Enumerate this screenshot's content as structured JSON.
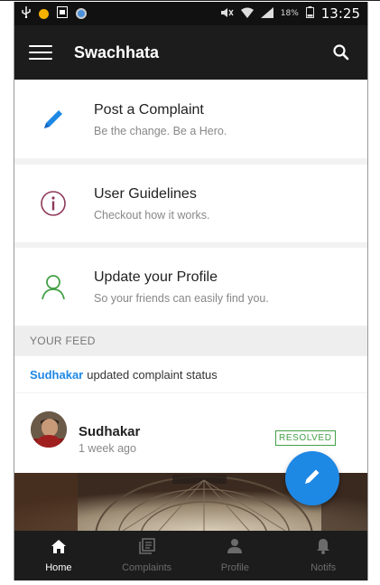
{
  "status_bar": {
    "battery_percent": "18%",
    "time": "13:25",
    "icons": [
      "usb-icon",
      "notification-dot-icon",
      "gallery-icon",
      "chrome-icon",
      "mute-icon",
      "wifi-icon",
      "signal-icon",
      "battery-icon"
    ]
  },
  "app_bar": {
    "title": "Swachhata",
    "icons": [
      "menu-icon",
      "search-icon"
    ]
  },
  "cards": [
    {
      "title": "Post a Complaint",
      "subtitle": "Be the change. Be a Hero.",
      "icon": "pencil-icon",
      "color": "#1e88e5"
    },
    {
      "title": "User Guidelines",
      "subtitle": "Checkout how it works.",
      "icon": "info-icon",
      "color": "#8e3a5a"
    },
    {
      "title": "Update your Profile",
      "subtitle": "So your friends can easily find you.",
      "icon": "person-icon",
      "color": "#43a047"
    }
  ],
  "feed": {
    "header": "YOUR FEED",
    "activity_user": "Sudhakar",
    "activity_text": "updated complaint status",
    "post": {
      "user": "Sudhakar",
      "time": "1 week ago",
      "status": "RESOLVED",
      "status_color": "#43a047"
    }
  },
  "fab": {
    "icon": "pencil-icon",
    "color": "#1e88e5"
  },
  "bottom_nav": [
    {
      "label": "Home",
      "icon": "home-icon",
      "active": true
    },
    {
      "label": "Complaints",
      "icon": "complaints-icon",
      "active": false
    },
    {
      "label": "Profile",
      "icon": "profile-icon",
      "active": false
    },
    {
      "label": "Notifs",
      "icon": "bell-icon",
      "active": false
    }
  ],
  "colors": {
    "app_bar": "#1c1c1c",
    "accent": "#1e88e5",
    "resolved": "#43a047"
  }
}
